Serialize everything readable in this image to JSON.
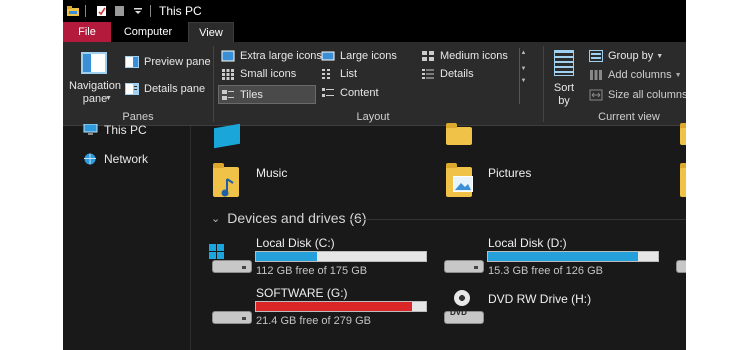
{
  "title_bar": {
    "title": "This PC"
  },
  "tabs": {
    "file": "File",
    "computer": "Computer",
    "view": "View"
  },
  "ribbon": {
    "panes": {
      "navigation_pane": "Navigation pane",
      "preview_pane": "Preview pane",
      "details_pane": "Details pane",
      "group_label": "Panes"
    },
    "layout": {
      "extra_large_icons": "Extra large icons",
      "large_icons": "Large icons",
      "medium_icons": "Medium icons",
      "small_icons": "Small icons",
      "list": "List",
      "details": "Details",
      "tiles": "Tiles",
      "content": "Content",
      "selected": "Tiles",
      "group_label": "Layout"
    },
    "current_view": {
      "sort_by": "Sort by",
      "group_by": "Group by",
      "add_columns": "Add columns",
      "size_all_columns": "Size all columns t",
      "group_label": "Current view"
    }
  },
  "nav": {
    "items": [
      {
        "label": "This PC",
        "icon": "computer-icon"
      },
      {
        "label": "Network",
        "icon": "network-icon"
      }
    ]
  },
  "folders": [
    {
      "label": "Music",
      "icon": "music-folder-icon"
    },
    {
      "label": "Pictures",
      "icon": "pictures-folder-icon"
    }
  ],
  "devices_section": {
    "title": "Devices and drives (6)"
  },
  "drives": [
    {
      "label": "Local Disk (C:)",
      "free_text": "112 GB free of 175 GB",
      "used_fraction": 0.36,
      "bar_color": "#26a0da",
      "icon": "windows-drive-icon"
    },
    {
      "label": "Local Disk (D:)",
      "free_text": "15.3 GB free of 126 GB",
      "used_fraction": 0.88,
      "bar_color": "#26a0da",
      "icon": "hard-drive-icon"
    },
    {
      "label": "SOFTWARE (G:)",
      "free_text": "21.4 GB free of 279 GB",
      "used_fraction": 0.92,
      "bar_color": "#da2626",
      "icon": "hard-drive-icon"
    },
    {
      "label": "DVD RW Drive (H:)",
      "free_text": "",
      "icon": "dvd-drive-icon"
    }
  ],
  "colors": {
    "file_tab": "#b41a3c",
    "window_bg": "#191919",
    "ribbon_bg": "#2b2b2b",
    "bar_normal": "#26a0da",
    "bar_full": "#da2626"
  }
}
